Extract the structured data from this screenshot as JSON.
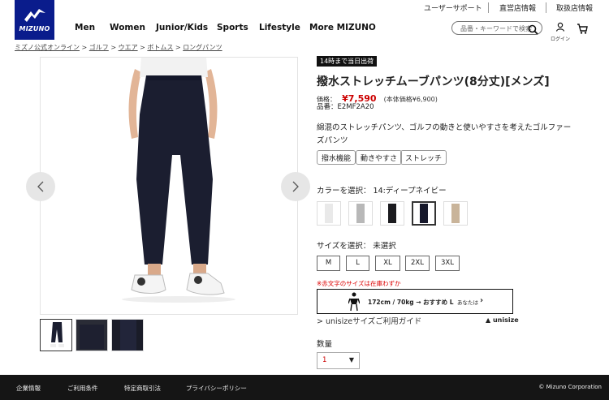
{
  "utility_links": [
    "ユーザーサポート",
    "直営店情報",
    "取扱店情報"
  ],
  "brand": {
    "wordmark": "MIZUNO",
    "color": "#0a1c8c"
  },
  "nav": [
    "Men",
    "Women",
    "Junior/Kids",
    "Sports",
    "Lifestyle",
    "More MIZUNO"
  ],
  "search": {
    "placeholder": "品番・キーワードで検索",
    "icon": "search-icon"
  },
  "login_label": "ログイン",
  "breadcrumb": [
    "ミズノ公式オンライン",
    "ゴルフ",
    "ウエア",
    "ボトムス",
    "ロングパンツ"
  ],
  "breadcrumb_sep": " >",
  "gallery": {
    "prev_icon": "chevron-left-icon",
    "next_icon": "chevron-right-icon",
    "thumb_count": 3
  },
  "product": {
    "badge": "14時まで当日出荷",
    "title": "撥水ストレッチムーブパンツ(8分丈)[メンズ]",
    "price_label": "価格：",
    "price": "¥7,590",
    "price_note": "(本体価格¥6,900)",
    "sku": "品番：E2MF2A20",
    "description": "綿混のストレッチパンツ、ゴルフの動きと使いやすさを考えたゴルファーズパンツ",
    "tags": [
      "撥水機能",
      "動きやすさ",
      "ストレッチ"
    ],
    "price_color": "#cc0000"
  },
  "color_select": {
    "label": "カラーを選択： 14:ディープネイビー",
    "swatches": [
      "#e9e9e9",
      "#b8b8b8",
      "#1b1b1f",
      "#16182b",
      "#c9b49a"
    ],
    "selected_index": 3
  },
  "size_select": {
    "label": "サイズを選択： 未選択",
    "sizes": [
      "M",
      "L",
      "XL",
      "2XL",
      "3XL"
    ],
    "stock_note": "※赤文字のサイズは在庫わずか"
  },
  "unisize": {
    "recommend": "172cm / 70kg → おすすめ L",
    "you": "あなたは",
    "guide": "> unisizeサイズご利用ガイド",
    "logo": "unisize"
  },
  "quantity": {
    "label": "数量",
    "value": "1"
  },
  "footer": {
    "links": [
      "企業情報",
      "ご利用条件",
      "特定商取引法",
      "プライバシーポリシー"
    ],
    "copyright": "© Mizuno Corporation"
  }
}
